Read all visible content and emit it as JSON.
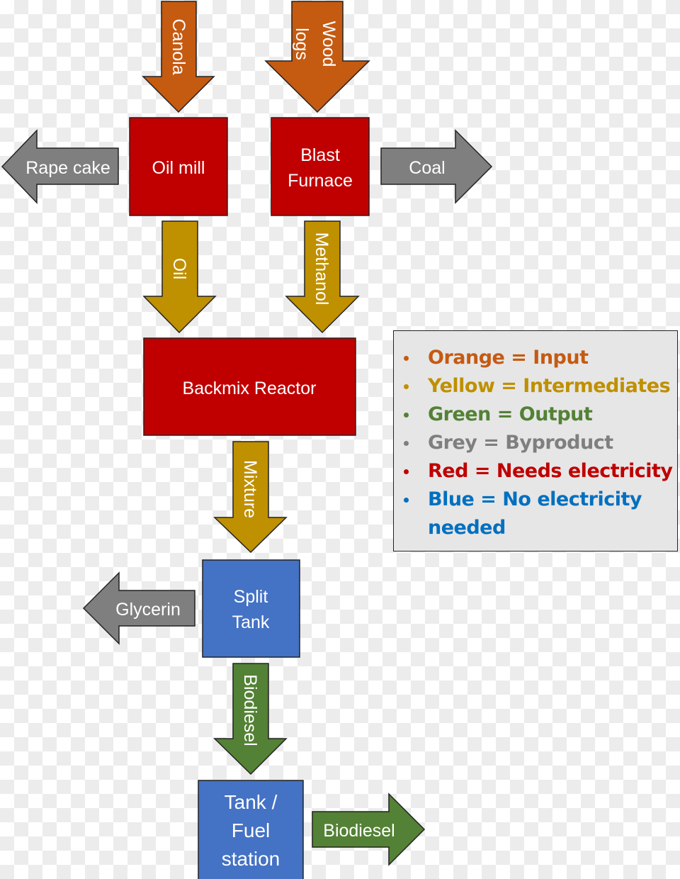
{
  "colors": {
    "input": "#c55a11",
    "intermediate": "#bf9000",
    "output": "#538135",
    "byproduct": "#7f7f7f",
    "needs_electricity": "#c00000",
    "no_electricity": "#4472c4"
  },
  "arrows": {
    "canola": "Canola",
    "wood_logs_line1": "Wood",
    "wood_logs_line2": "logs",
    "rape_cake": "Rape cake",
    "coal": "Coal",
    "oil": "Oil",
    "methanol": "Methanol",
    "mixture": "Mixture",
    "glycerin": "Glycerin",
    "biodiesel_down": "Biodiesel",
    "biodiesel_out": "Biodiesel"
  },
  "boxes": {
    "oil_mill": "Oil mill",
    "blast_furnace_line1": "Blast",
    "blast_furnace_line2": "Furnace",
    "backmix_reactor": "Backmix Reactor",
    "split_tank_line1": "Split",
    "split_tank_line2": "Tank",
    "fuel_station_line1": "Tank /",
    "fuel_station_line2": "Fuel",
    "fuel_station_line3": "station"
  },
  "legend": {
    "items": [
      {
        "text": "Orange = Input",
        "color": "#c55a11"
      },
      {
        "text": "Yellow = Intermediates",
        "color": "#bf9000"
      },
      {
        "text": "Green = Output",
        "color": "#538135"
      },
      {
        "text": "Grey = Byproduct",
        "color": "#7f7f7f"
      },
      {
        "text": "Red = Needs electricity",
        "color": "#c00000"
      },
      {
        "text": "Blue = No electricity needed",
        "color": "#0070c0"
      }
    ]
  }
}
